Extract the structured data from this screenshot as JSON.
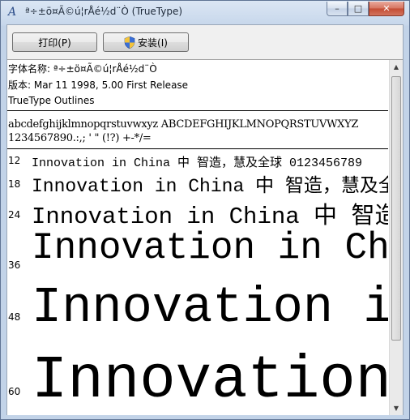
{
  "window": {
    "title": "ª÷±ö¤Ã©ú¦rÅé½d¨Ò (TrueType)",
    "icon": "font-icon"
  },
  "controls": {
    "minimize": "–",
    "maximize": "□",
    "close": "✕"
  },
  "toolbar": {
    "print_label": "打印(P)",
    "install_label": "安装(I)"
  },
  "info": {
    "font_name": "字体名称: ª÷±ö¤Ã©ú¦rÅé½d¨Ò",
    "version": "版本: Mar 11 1998, 5.00 First Release",
    "outlines": "TrueType Outlines"
  },
  "charset": {
    "line1": "abcdefghijklmnopqrstuvwxyz ABCDEFGHIJKLMNOPQRSTUVWXYZ",
    "line2": "1234567890.:,; ' \" (!?) +-*/="
  },
  "samples": [
    {
      "size": "12",
      "text": "Innovation in China 中  智造，慧及全球 0123456789"
    },
    {
      "size": "18",
      "text": "Innovation in China 中  智造，慧及全球"
    },
    {
      "size": "24",
      "text": "Innovation in China 中  智造，慧及全球"
    },
    {
      "size": "36",
      "text": "Innovation in China"
    },
    {
      "size": "48",
      "text": "Innovation in"
    },
    {
      "size": "60",
      "text": "Innovation"
    }
  ],
  "scrollbar": {
    "up_arrow": "▲",
    "down_arrow": "▼"
  }
}
